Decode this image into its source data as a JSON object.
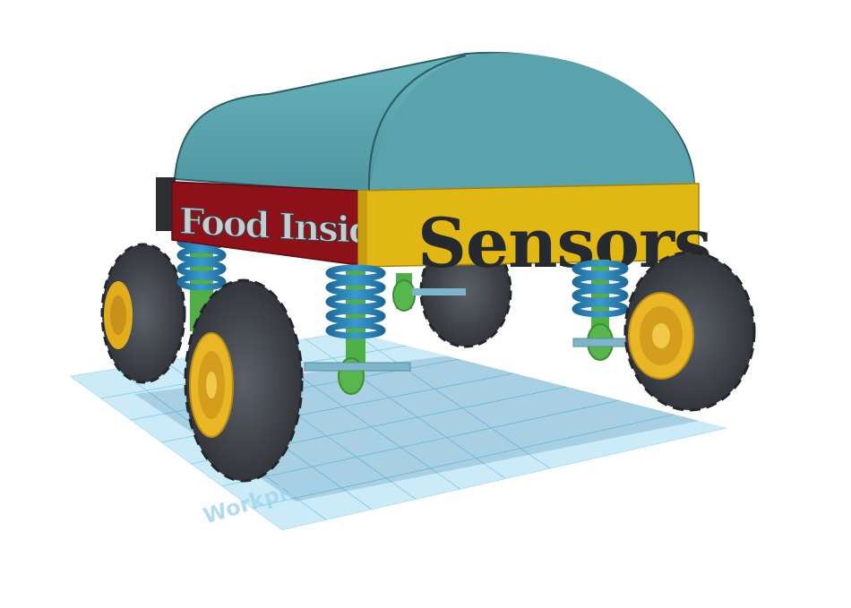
{
  "scene": {
    "background": "#ffffff",
    "workplane": {
      "fill": "#bfe6f7",
      "grid_color": "#6fc3e6",
      "label": "Workplane"
    },
    "model": {
      "canopy_color": "#5aa3ad",
      "red_panel_color": "#8e1119",
      "yellow_panel_color": "#e1b714",
      "red_panel_text": "Food Inside",
      "yellow_panel_text": "Sensors",
      "spring_color": "#2b82b5",
      "strut_color": "#58b64d",
      "axle_color": "#7fb5c8",
      "tire_color": "#4a4e55",
      "rim_color": "#e9b725"
    }
  }
}
